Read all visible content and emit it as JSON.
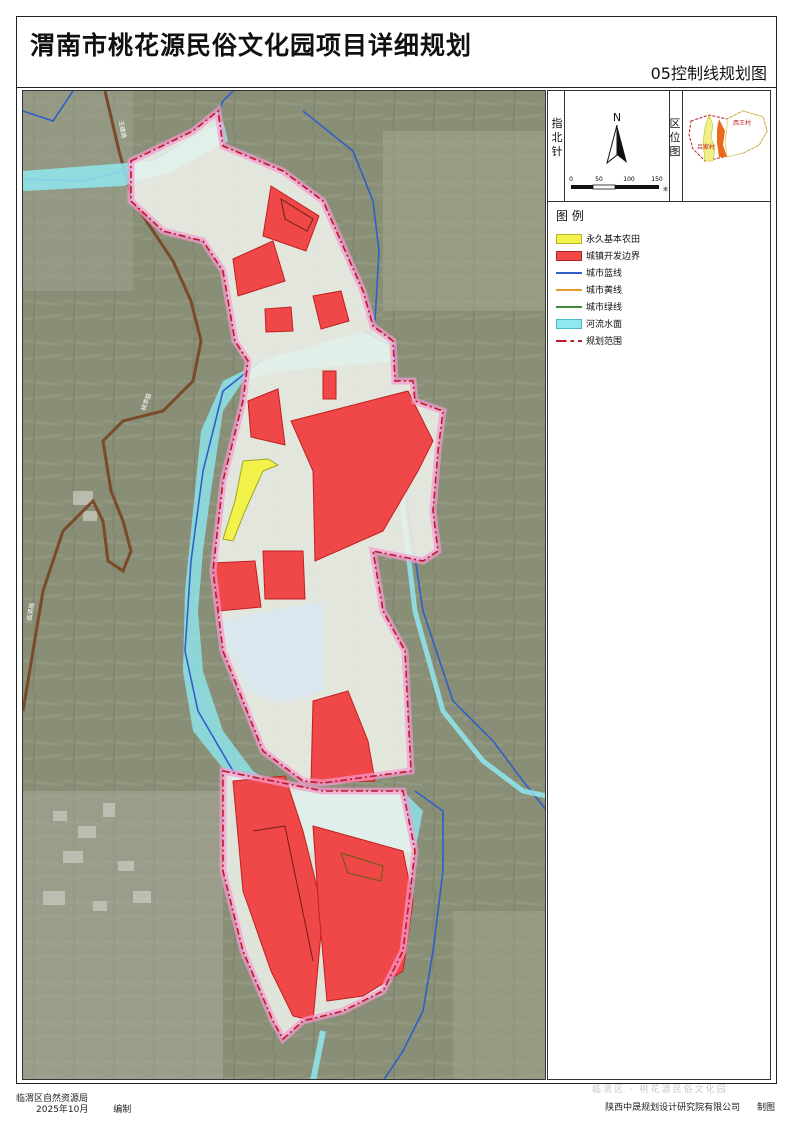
{
  "header": {
    "title": "渭南市桃花源民俗文化园项目详细规划",
    "subtitle": "05控制线规划图"
  },
  "north_arrow": {
    "side_label": "指北针",
    "letter": "N",
    "scale_ticks": [
      "0",
      "50",
      "100",
      "150"
    ],
    "scale_unit": "米"
  },
  "location_map": {
    "side_label": "区位图",
    "village_east": "西王村",
    "village_west": "吕家村"
  },
  "legend": {
    "title": "图 例",
    "items": [
      {
        "label": "永久基本农田",
        "kind": "fill",
        "color": "#f2f24a",
        "border": "#b5b52a",
        "icon": "farmland-swatch"
      },
      {
        "label": "城镇开发边界",
        "kind": "fill",
        "color": "#f04848",
        "border": "#b22222",
        "icon": "development-swatch"
      },
      {
        "label": "城市蓝线",
        "kind": "line",
        "color": "#2f5fc9",
        "icon": "blue-line-swatch"
      },
      {
        "label": "城市黄线",
        "kind": "line",
        "color": "#e89a2c",
        "icon": "yellow-line-swatch"
      },
      {
        "label": "城市绿线",
        "kind": "line",
        "color": "#3f8a3a",
        "icon": "green-line-swatch"
      },
      {
        "label": "河流水面",
        "kind": "fill",
        "color": "#8fe8f0",
        "border": "#4cb8c8",
        "icon": "water-swatch"
      },
      {
        "label": "规划范围",
        "kind": "dash",
        "color": "#c01828",
        "icon": "boundary-swatch"
      }
    ]
  },
  "map": {
    "road_labels": [
      "玉蟾路",
      "桃李路",
      "临渭路"
    ]
  },
  "footer": {
    "left_org": "临渭区自然资源局",
    "left_date": "2025年10月",
    "left_action": "编制",
    "right_org": "陕西中晟规划设计研究院有限公司",
    "right_action": "制图",
    "watermark": "临渭区 · 桃花源民俗文化园"
  }
}
